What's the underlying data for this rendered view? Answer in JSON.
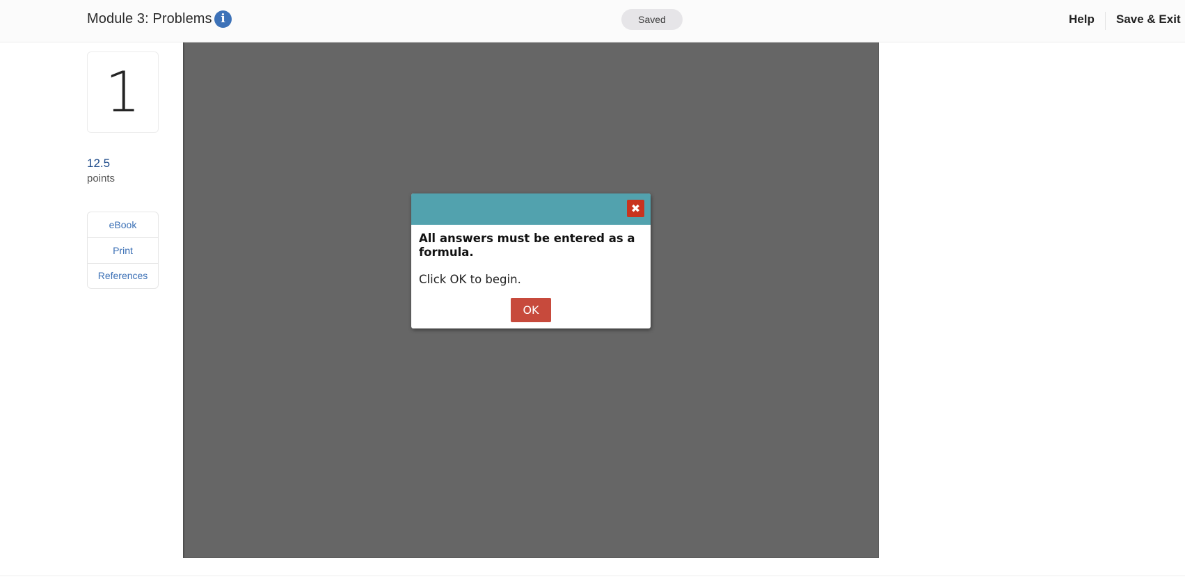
{
  "header": {
    "title": "Module 3: Problems",
    "info_icon": "info-icon",
    "save_status": "Saved",
    "help_label": "Help",
    "save_exit_label": "Save & Exit"
  },
  "sidebar": {
    "question_number": "1",
    "points_value": "12.5",
    "points_label": "points",
    "tools": [
      {
        "label": "eBook"
      },
      {
        "label": "Print"
      },
      {
        "label": "References"
      }
    ]
  },
  "dialog": {
    "close_icon": "close-icon",
    "close_glyph": "✖",
    "message_bold": "All answers must be entered as a formula.",
    "message": "Click OK to begin.",
    "ok_label": "OK"
  },
  "colors": {
    "dialog_header": "#52a2ae",
    "close_button": "#c9341f",
    "ok_button": "#c74a3c",
    "info_icon": "#3d72b8",
    "link": "#3a6fb5",
    "points": "#1e4b8a",
    "panel": "#666666"
  }
}
